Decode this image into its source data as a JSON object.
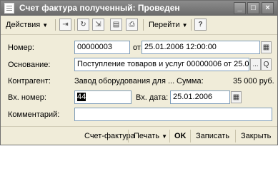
{
  "window": {
    "title": "Счет фактура полученный: Проведен",
    "minimize_glyph": "_",
    "maximize_glyph": "□",
    "close_glyph": "×"
  },
  "toolbar": {
    "actions_label": "Действия",
    "goto_label": "Перейти",
    "help_glyph": "?",
    "icons": [
      "go-to-icon",
      "refresh-icon",
      "post-icon",
      "structure-icon",
      "print-icon"
    ]
  },
  "form": {
    "number_label": "Номер:",
    "number_value": "00000003",
    "from_label": "от:",
    "date_value": "25.01.2006 12:00:00",
    "basis_label": "Основание:",
    "basis_value": "Поступление товаров и услуг 00000006 от 25.01.2...",
    "select_glyph": "...",
    "open_glyph": "Q",
    "contractor_label": "Контрагент:",
    "contractor_value": "Завод оборудования для ...",
    "sum_label": "Сумма:",
    "sum_value": "35 000 руб.",
    "in_number_label": "Вх. номер:",
    "in_number_value": "44",
    "in_date_label": "Вх. дата:",
    "in_date_value": "25.01.2006",
    "comment_label": "Комментарий:",
    "comment_value": ""
  },
  "bottom": {
    "invoice_label": "Счет-фактура",
    "print_label": "Печать",
    "ok_label": "OK",
    "save_label": "Записать",
    "close_label": "Закрыть"
  }
}
